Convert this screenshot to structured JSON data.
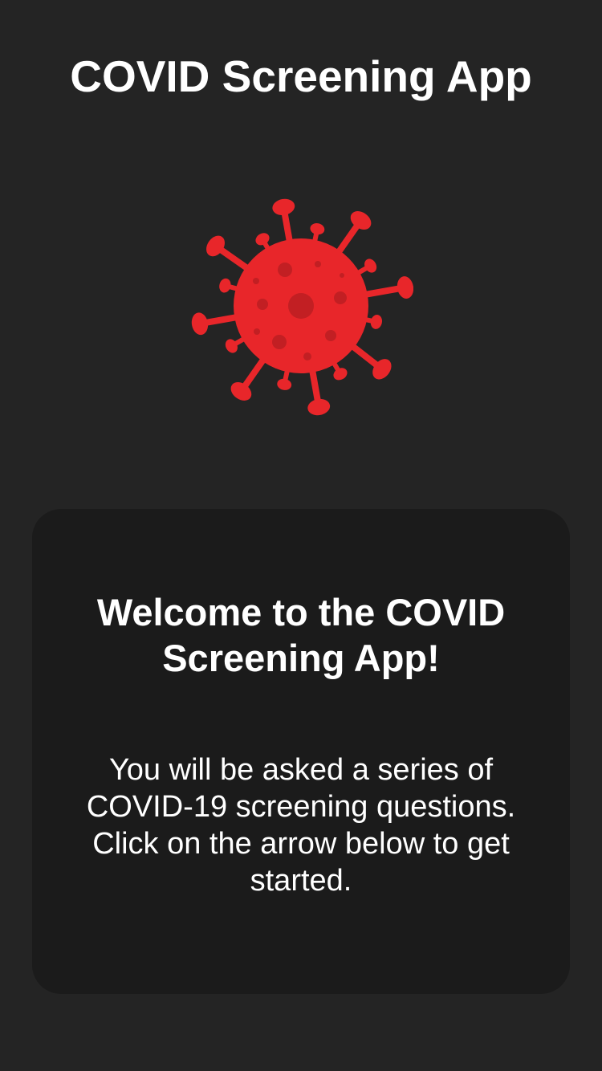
{
  "header": {
    "title": "COVID Screening App"
  },
  "hero": {
    "icon": "virus-icon",
    "icon_color": "#e8262a",
    "icon_spot_color": "#c21f23"
  },
  "welcome_card": {
    "heading": "Welcome to the COVID Screening App!",
    "body": "You will be asked a series of COVID-19 screening questions. Click on the arrow below to get started."
  },
  "colors": {
    "background": "#242424",
    "card": "#1b1b1b",
    "text": "#ffffff"
  }
}
